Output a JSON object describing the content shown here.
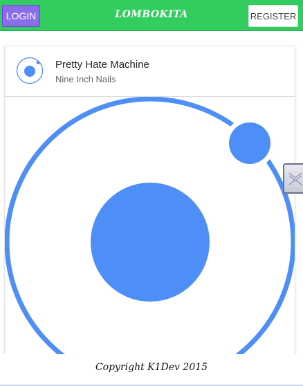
{
  "header": {
    "login_label": "LOGIN",
    "brand": "LOMBOKITA",
    "register_label": "REGISTER"
  },
  "card": {
    "title": "Pretty Hate Machine",
    "artist": "Nine Inch Nails",
    "avatar_icon": "ionic-logo-icon",
    "image_icon": "ionic-logo-icon"
  },
  "footer": {
    "copyright": "Copyright K1Dev 2015"
  },
  "colors": {
    "header_bg": "#33cd5f",
    "login_bg": "#8a6de9",
    "logo_blue": "#4e8ef7"
  }
}
